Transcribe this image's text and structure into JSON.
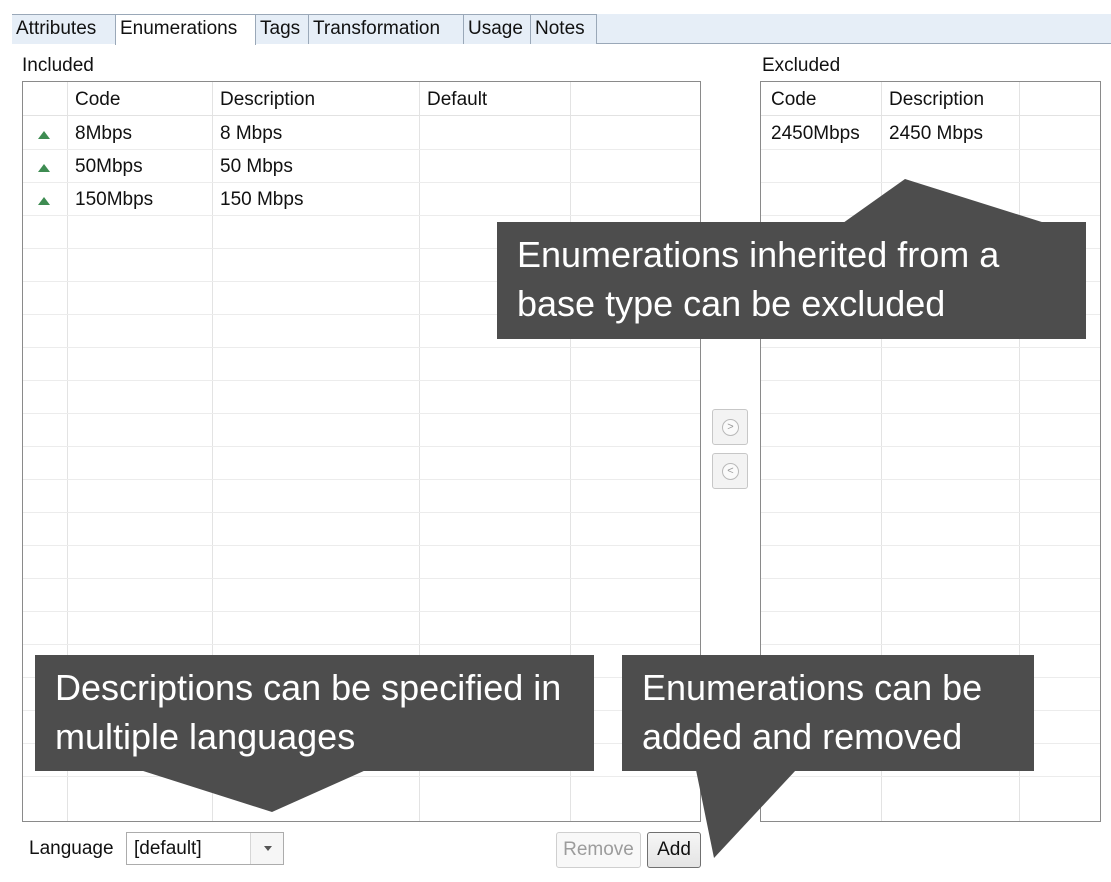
{
  "tabs": [
    "Attributes",
    "Enumerations",
    "Tags",
    "Transformation",
    "Usage",
    "Notes"
  ],
  "active_tab": "Enumerations",
  "included": {
    "label": "Included",
    "columns": [
      "Code",
      "Description",
      "Default"
    ],
    "rows": [
      {
        "code": "8Mbps",
        "description": "8 Mbps",
        "default": "",
        "inherited_icon": "inherited-triangle-icon"
      },
      {
        "code": "50Mbps",
        "description": "50 Mbps",
        "default": "",
        "inherited_icon": "inherited-triangle-icon"
      },
      {
        "code": "150Mbps",
        "description": "150 Mbps",
        "default": "",
        "inherited_icon": "inherited-triangle-icon"
      }
    ]
  },
  "excluded": {
    "label": "Excluded",
    "columns": [
      "Code",
      "Description"
    ],
    "rows": [
      {
        "code": "2450Mbps",
        "description": "2450 Mbps"
      }
    ]
  },
  "move_buttons": {
    "exclude_icon": "move-right-icon",
    "include_icon": "move-left-icon"
  },
  "language": {
    "label": "Language",
    "value": "[default]"
  },
  "buttons": {
    "remove": "Remove",
    "add": "Add"
  },
  "callouts": {
    "inherited": "Enumerations inherited from a base type can be excluded",
    "languages": "Descriptions can be specified in multiple languages",
    "add_remove": "Enumerations can be added and removed"
  },
  "colors": {
    "callout_bg": "#4d4d4d",
    "tab_bg": "#e6eef7",
    "inherited_icon": "#3e8c52"
  }
}
